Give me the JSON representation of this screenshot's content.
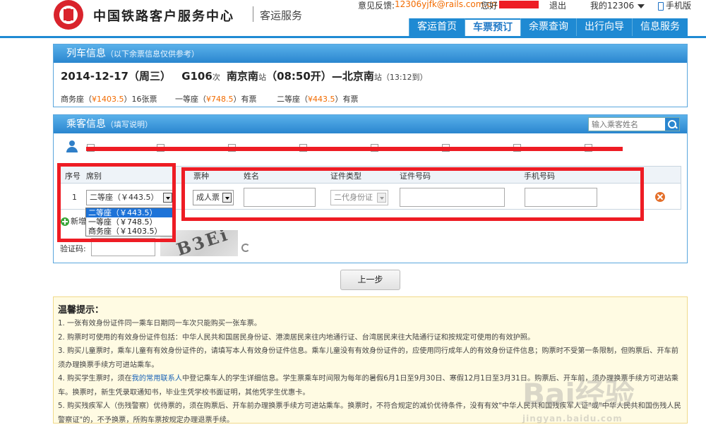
{
  "header": {
    "site_name": "中国铁路客户服务中心",
    "site_sub": "客运服务",
    "feedback_label": "意见反馈:",
    "feedback_email": "12306yjfk@rails.com.cn",
    "greeting": "您好",
    "logout": "退出",
    "my_account": "我的12306",
    "mobile": "手机版"
  },
  "nav": {
    "items": [
      "客运首页",
      "车票预订",
      "余票查询",
      "出行向导",
      "信息服务"
    ],
    "active": "车票预订"
  },
  "train": {
    "title": "列车信息",
    "note": "（以下余票信息仅供参考）",
    "date": "2014-12-17（周三）",
    "train_no": "G106",
    "train_suffix": "次",
    "from": "南京南",
    "station_suffix": "站",
    "depart": "（08:50开）",
    "arrow": "—",
    "to": "北京南",
    "arrive": "（13:12到）",
    "fares": [
      {
        "seat": "商务座（",
        "price": "¥1403.5",
        "close": "）",
        "avail": "16张票"
      },
      {
        "seat": "一等座（",
        "price": "¥748.5",
        "close": "）",
        "avail": "有票"
      },
      {
        "seat": "二等座（",
        "price": "¥443.5",
        "close": "）",
        "avail": "有票"
      }
    ]
  },
  "passenger": {
    "title": "乘客信息",
    "note": "（填写说明）",
    "search_placeholder": "输入乘客姓名",
    "headers": [
      "序号",
      "席别",
      "票种",
      "姓名",
      "证件类型",
      "证件号码",
      "手机号码"
    ],
    "row": {
      "no": "1",
      "seat": "二等座（￥443.5）",
      "ticket_type": "成人票",
      "id_type": "二代身份证"
    },
    "seat_options": [
      "二等座（￥443.5）",
      "一等座（￥748.5）",
      "商务座（￥1403.5）"
    ],
    "add_label": "新增",
    "captcha_label": "验证码:",
    "captcha_text": "B3Ei"
  },
  "buttons": {
    "prev": "上一步"
  },
  "tips": {
    "title": "温馨提示：",
    "items": [
      "1. 一张有效身份证件同一乘车日期同一车次只能购买一张车票。",
      "2. 购票时可使用的有效身份证件包括：中华人民共和国居民身份证、港澳居民来往内地通行证、台湾居民来往大陆通行证和按规定可使用的有效护照。",
      "3. 购买儿童票时，乘车儿童有有效身份证件的，请填写本人有效身份证件信息。乘车儿童没有有效身份证件的，应使用同行成年人的有效身份证件信息；购票时不受第一条限制，但购票后、开车前须办理换票手续方可进站乘车。"
    ],
    "tip4_prefix": "4. 购买学生票时，须在",
    "tip4_link": "我的常用联系人",
    "tip4_suffix": "中登记乘车人的学生详细信息。学生票乘车时间限为每年的暑假6月1日至9月30日、寒假12月1日至3月31日。购票后、开车前，须办理换票手续方可进站乘车。换票时，新生凭录取通知书，毕业生凭学校书面证明，其他凭学生优惠卡。",
    "tip5": "5. 购买残疾军人（伤残警察）优待票的，须在购票后、开车前办理换票手续方可进站乘车。换票时，不符合规定的减价优待条件，没有有效\"中华人民共和国残疾军人证\"或\"中华人民共和国伤残人民警察证\"的，不予换票，所购车票按规定办理退票手续。"
  },
  "watermark": {
    "text": "Bai经验",
    "sub": "jingyan.baidu.com"
  },
  "colors": {
    "brand_blue": "#1f8ad3",
    "price_orange": "#f26b00",
    "highlight_red": "#ee1c24",
    "selected_blue": "#1e73d8"
  }
}
